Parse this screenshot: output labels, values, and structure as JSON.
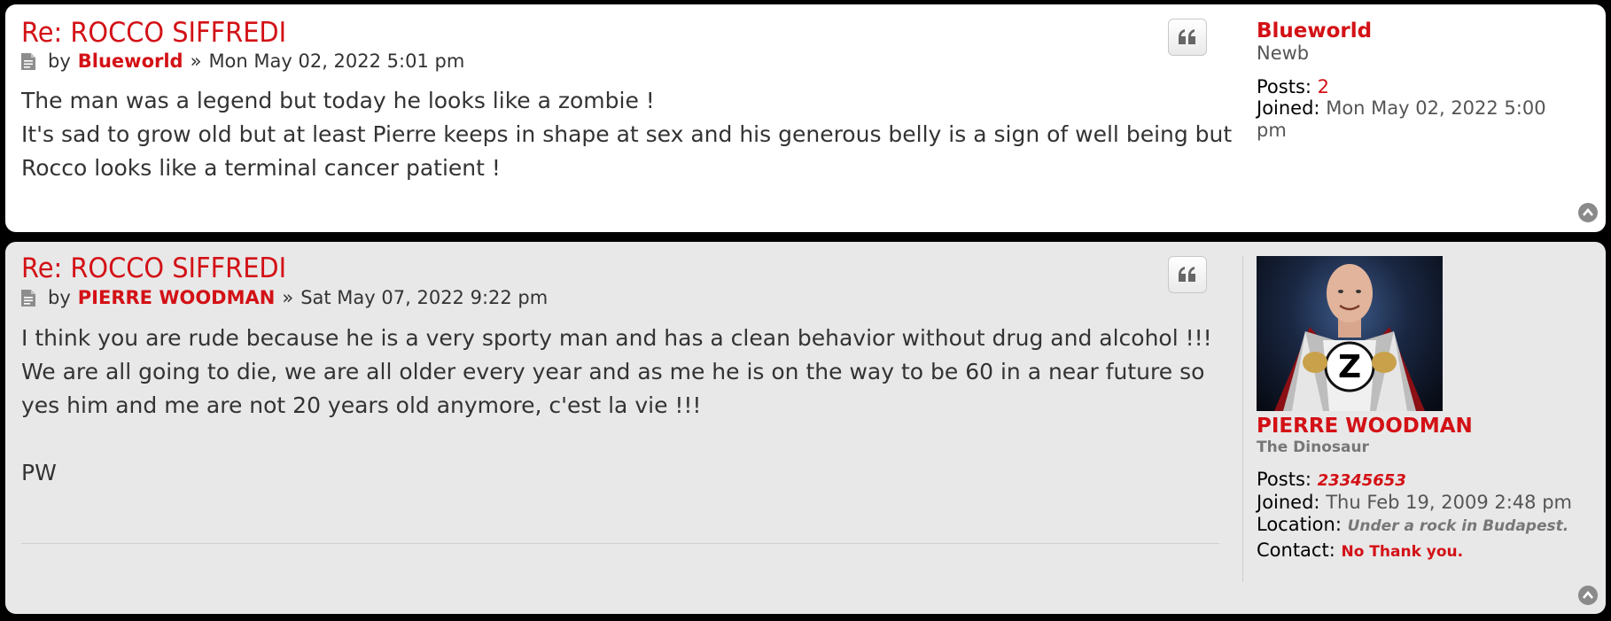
{
  "posts": [
    {
      "title": "Re: ROCCO SIFFREDI",
      "by_label": "by",
      "author": "Blueworld",
      "separator": "»",
      "date": "Mon May 02, 2022 5:01 pm",
      "content_lines": [
        "The man was a legend but today he looks like a zombie !",
        "It's sad to grow old but at least Pierre keeps in shape at sex and his generous belly is a sign of well being but",
        "Rocco looks like a terminal cancer patient !"
      ],
      "profile": {
        "username": "Blueworld",
        "rank": "Newb",
        "posts_label": "Posts:",
        "posts_value": "2",
        "joined_label": "Joined:",
        "joined_value_line1": "Mon May 02, 2022 5:00",
        "joined_value_line2": "pm"
      }
    },
    {
      "title": "Re: ROCCO SIFFREDI",
      "by_label": "by",
      "author": "PIERRE WOODMAN",
      "separator": "»",
      "date": "Sat May 07, 2022 9:22 pm",
      "content_lines": [
        "I think you are rude because he is a very sporty man and has a clean behavior without drug and alcohol !!!",
        "We are all going to die, we are all older every year and as me he is on the way to be 60 in a near future so",
        "yes him and me are not 20 years old anymore, c'est la vie !!!",
        "",
        "PW"
      ],
      "profile": {
        "avatar_letter": "Z",
        "username": "PIERRE WOODMAN",
        "rank": "The Dinosaur",
        "posts_label": "Posts:",
        "posts_value": "23345653",
        "joined_label": "Joined:",
        "joined_value": "Thu Feb 19, 2009 2:48 pm",
        "location_label": "Location:",
        "location_value": "Under a rock in Budapest.",
        "contact_label": "Contact:",
        "contact_value": "No Thank you."
      }
    }
  ],
  "colors": {
    "accent": "#d31116",
    "post1_bg": "#ffffff",
    "post2_bg": "#e8e8e8",
    "page_bg": "#000000"
  },
  "icons": [
    "post-icon",
    "quote-icon",
    "back-to-top-icon"
  ]
}
